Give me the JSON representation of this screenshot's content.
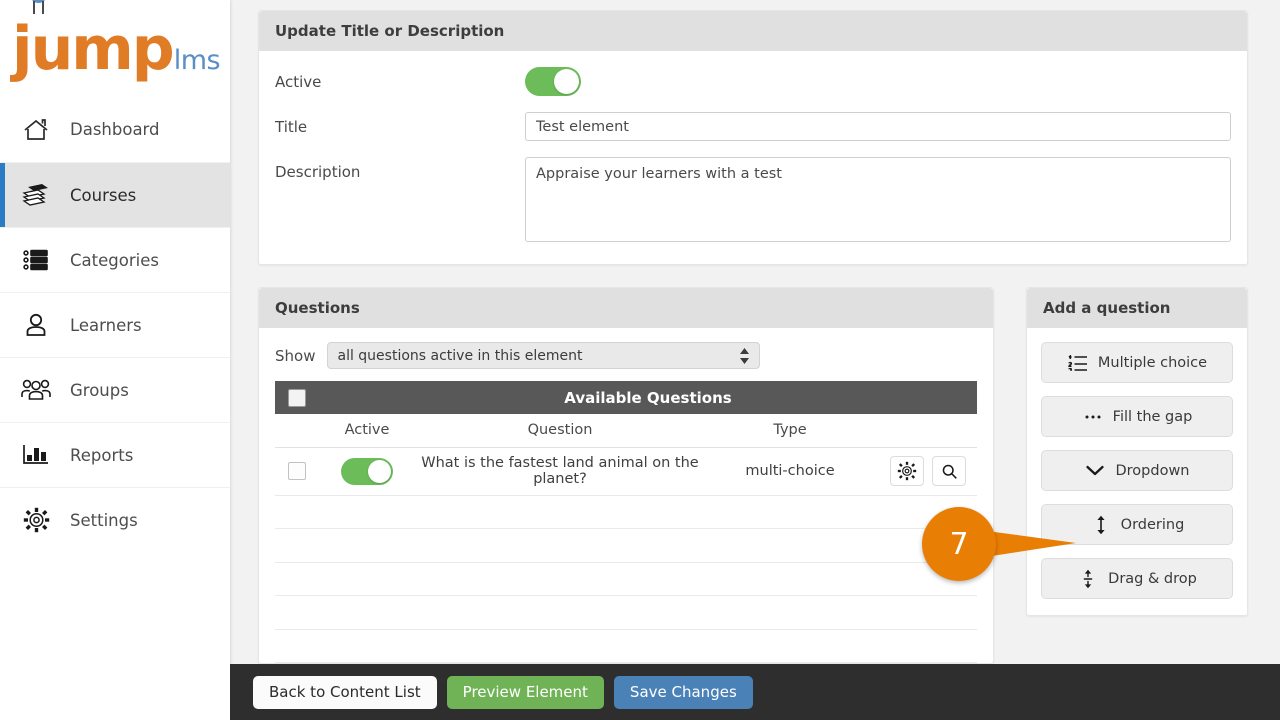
{
  "sidebar": {
    "logo": {
      "primary": "jump",
      "secondary": "lms",
      "primary_color": "#e07b26",
      "secondary_color": "#5b8ec4"
    },
    "items": [
      {
        "label": "Dashboard",
        "icon": "home-icon",
        "active": false
      },
      {
        "label": "Courses",
        "icon": "books-icon",
        "active": true
      },
      {
        "label": "Categories",
        "icon": "list-icon",
        "active": false
      },
      {
        "label": "Learners",
        "icon": "user-icon",
        "active": false
      },
      {
        "label": "Groups",
        "icon": "users-icon",
        "active": false
      },
      {
        "label": "Reports",
        "icon": "bar-chart-icon",
        "active": false
      },
      {
        "label": "Settings",
        "icon": "gear-icon",
        "active": false
      }
    ],
    "active_indicator_color": "#2b7cc4"
  },
  "update_panel": {
    "title": "Update Title or Description",
    "active_label": "Active",
    "active_on": true,
    "toggle_color": "#6cbd5a",
    "title_label": "Title",
    "title_value": "Test element",
    "title_placeholder": "",
    "description_label": "Description",
    "description_value": "Appraise your learners with a test",
    "description_placeholder": ""
  },
  "questions_panel": {
    "title": "Questions",
    "show_label": "Show",
    "show_value": "all questions active in this element",
    "table": {
      "banner": "Available Questions",
      "select_all_checked": false,
      "columns": [
        "Active",
        "Question",
        "Type"
      ],
      "rows": [
        {
          "checked": false,
          "active": true,
          "question": "What is the fastest land animal on the planet?",
          "type": "multi-choice",
          "actions": [
            "settings-gear-icon",
            "search-icon"
          ]
        }
      ],
      "empty_rows": 5
    }
  },
  "add_panel": {
    "title": "Add a question",
    "buttons": [
      {
        "label": "Multiple choice",
        "icon": "numbered-list-icon"
      },
      {
        "label": "Fill the gap",
        "icon": "ellipsis-icon"
      },
      {
        "label": "Dropdown",
        "icon": "chevron-down-icon"
      },
      {
        "label": "Ordering",
        "icon": "up-down-arrow-icon"
      },
      {
        "label": "Drag & drop",
        "icon": "drag-handle-icon"
      }
    ]
  },
  "callout": {
    "number": "7",
    "color": "#e87e04",
    "points_to": "Ordering"
  },
  "bottom_bar": {
    "back_label": "Back to Content List",
    "preview_label": "Preview Element",
    "save_label": "Save Changes",
    "preview_color": "#6fb356",
    "save_color": "#4a82b8"
  }
}
